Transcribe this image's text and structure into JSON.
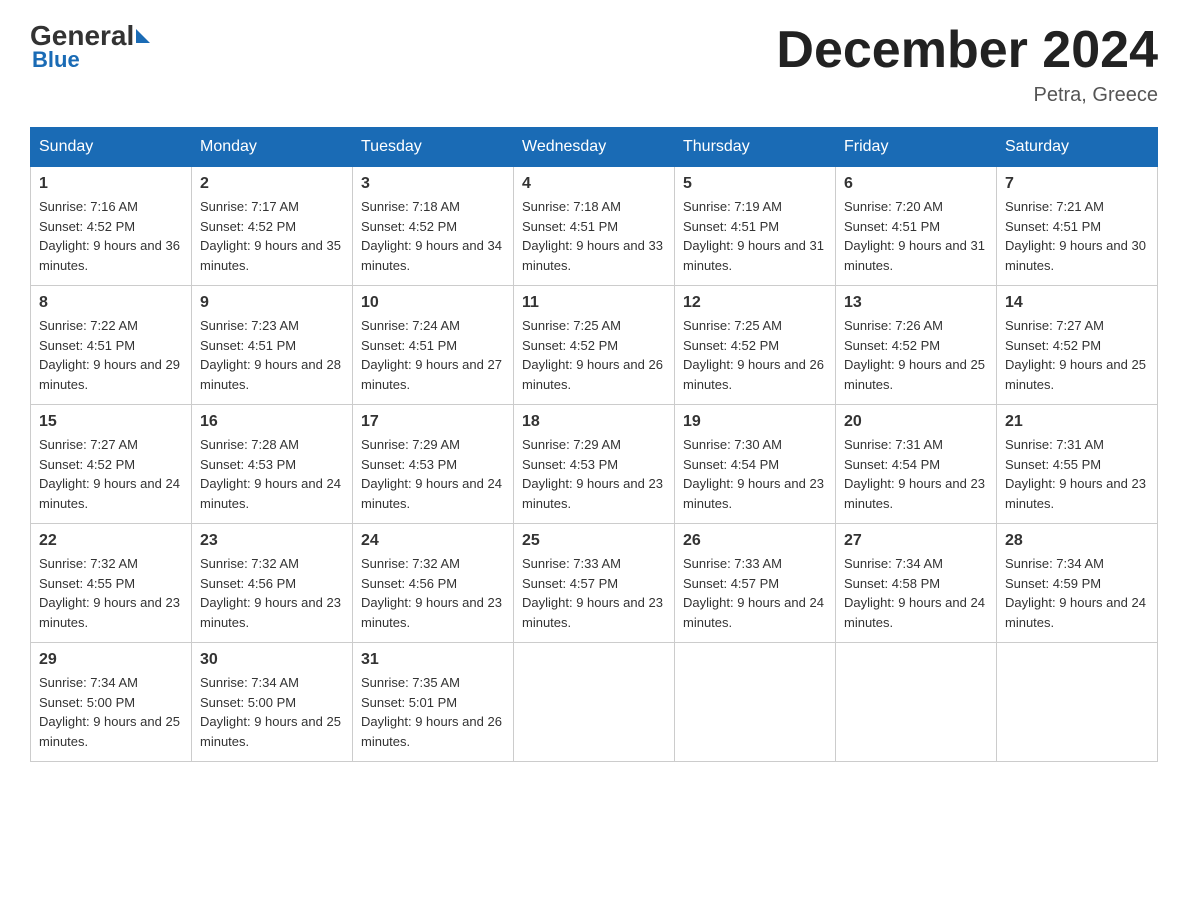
{
  "logo": {
    "general": "General",
    "blue": "Blue"
  },
  "title": "December 2024",
  "location": "Petra, Greece",
  "days_of_week": [
    "Sunday",
    "Monday",
    "Tuesday",
    "Wednesday",
    "Thursday",
    "Friday",
    "Saturday"
  ],
  "weeks": [
    [
      {
        "day": "1",
        "sunrise": "7:16 AM",
        "sunset": "4:52 PM",
        "daylight": "9 hours and 36 minutes."
      },
      {
        "day": "2",
        "sunrise": "7:17 AM",
        "sunset": "4:52 PM",
        "daylight": "9 hours and 35 minutes."
      },
      {
        "day": "3",
        "sunrise": "7:18 AM",
        "sunset": "4:52 PM",
        "daylight": "9 hours and 34 minutes."
      },
      {
        "day": "4",
        "sunrise": "7:18 AM",
        "sunset": "4:51 PM",
        "daylight": "9 hours and 33 minutes."
      },
      {
        "day": "5",
        "sunrise": "7:19 AM",
        "sunset": "4:51 PM",
        "daylight": "9 hours and 31 minutes."
      },
      {
        "day": "6",
        "sunrise": "7:20 AM",
        "sunset": "4:51 PM",
        "daylight": "9 hours and 31 minutes."
      },
      {
        "day": "7",
        "sunrise": "7:21 AM",
        "sunset": "4:51 PM",
        "daylight": "9 hours and 30 minutes."
      }
    ],
    [
      {
        "day": "8",
        "sunrise": "7:22 AM",
        "sunset": "4:51 PM",
        "daylight": "9 hours and 29 minutes."
      },
      {
        "day": "9",
        "sunrise": "7:23 AM",
        "sunset": "4:51 PM",
        "daylight": "9 hours and 28 minutes."
      },
      {
        "day": "10",
        "sunrise": "7:24 AM",
        "sunset": "4:51 PM",
        "daylight": "9 hours and 27 minutes."
      },
      {
        "day": "11",
        "sunrise": "7:25 AM",
        "sunset": "4:52 PM",
        "daylight": "9 hours and 26 minutes."
      },
      {
        "day": "12",
        "sunrise": "7:25 AM",
        "sunset": "4:52 PM",
        "daylight": "9 hours and 26 minutes."
      },
      {
        "day": "13",
        "sunrise": "7:26 AM",
        "sunset": "4:52 PM",
        "daylight": "9 hours and 25 minutes."
      },
      {
        "day": "14",
        "sunrise": "7:27 AM",
        "sunset": "4:52 PM",
        "daylight": "9 hours and 25 minutes."
      }
    ],
    [
      {
        "day": "15",
        "sunrise": "7:27 AM",
        "sunset": "4:52 PM",
        "daylight": "9 hours and 24 minutes."
      },
      {
        "day": "16",
        "sunrise": "7:28 AM",
        "sunset": "4:53 PM",
        "daylight": "9 hours and 24 minutes."
      },
      {
        "day": "17",
        "sunrise": "7:29 AM",
        "sunset": "4:53 PM",
        "daylight": "9 hours and 24 minutes."
      },
      {
        "day": "18",
        "sunrise": "7:29 AM",
        "sunset": "4:53 PM",
        "daylight": "9 hours and 23 minutes."
      },
      {
        "day": "19",
        "sunrise": "7:30 AM",
        "sunset": "4:54 PM",
        "daylight": "9 hours and 23 minutes."
      },
      {
        "day": "20",
        "sunrise": "7:31 AM",
        "sunset": "4:54 PM",
        "daylight": "9 hours and 23 minutes."
      },
      {
        "day": "21",
        "sunrise": "7:31 AM",
        "sunset": "4:55 PM",
        "daylight": "9 hours and 23 minutes."
      }
    ],
    [
      {
        "day": "22",
        "sunrise": "7:32 AM",
        "sunset": "4:55 PM",
        "daylight": "9 hours and 23 minutes."
      },
      {
        "day": "23",
        "sunrise": "7:32 AM",
        "sunset": "4:56 PM",
        "daylight": "9 hours and 23 minutes."
      },
      {
        "day": "24",
        "sunrise": "7:32 AM",
        "sunset": "4:56 PM",
        "daylight": "9 hours and 23 minutes."
      },
      {
        "day": "25",
        "sunrise": "7:33 AM",
        "sunset": "4:57 PM",
        "daylight": "9 hours and 23 minutes."
      },
      {
        "day": "26",
        "sunrise": "7:33 AM",
        "sunset": "4:57 PM",
        "daylight": "9 hours and 24 minutes."
      },
      {
        "day": "27",
        "sunrise": "7:34 AM",
        "sunset": "4:58 PM",
        "daylight": "9 hours and 24 minutes."
      },
      {
        "day": "28",
        "sunrise": "7:34 AM",
        "sunset": "4:59 PM",
        "daylight": "9 hours and 24 minutes."
      }
    ],
    [
      {
        "day": "29",
        "sunrise": "7:34 AM",
        "sunset": "5:00 PM",
        "daylight": "9 hours and 25 minutes."
      },
      {
        "day": "30",
        "sunrise": "7:34 AM",
        "sunset": "5:00 PM",
        "daylight": "9 hours and 25 minutes."
      },
      {
        "day": "31",
        "sunrise": "7:35 AM",
        "sunset": "5:01 PM",
        "daylight": "9 hours and 26 minutes."
      },
      null,
      null,
      null,
      null
    ]
  ]
}
